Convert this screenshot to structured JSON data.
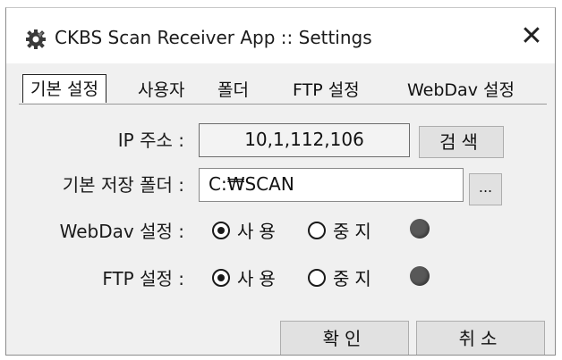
{
  "window": {
    "title": "CKBS Scan Receiver App :: Settings",
    "close_glyph": "✕",
    "icon": "gear-icon"
  },
  "tabs": [
    {
      "label": "기본 설정",
      "active": true
    },
    {
      "label": "사용자",
      "active": false
    },
    {
      "label": "폴더",
      "active": false
    },
    {
      "label": "FTP 설정",
      "active": false
    },
    {
      "label": "WebDav 설정",
      "active": false
    }
  ],
  "settings": {
    "ip_label": "IP 주소 :",
    "ip_value": "10,1,112,106",
    "search_label": "검색",
    "folder_label": "기본 저장 폴더 :",
    "folder_value": "C:₩SCAN",
    "browse_label": "...",
    "webdav_label": "WebDav 설정 :",
    "ftp_label": "FTP 설정 :",
    "use_label": "사용",
    "stop_label": "중지",
    "webdav_selected": "사용",
    "ftp_selected": "사용",
    "status_color": "#585858"
  },
  "footer": {
    "ok_label": "확인",
    "cancel_label": "취소"
  }
}
